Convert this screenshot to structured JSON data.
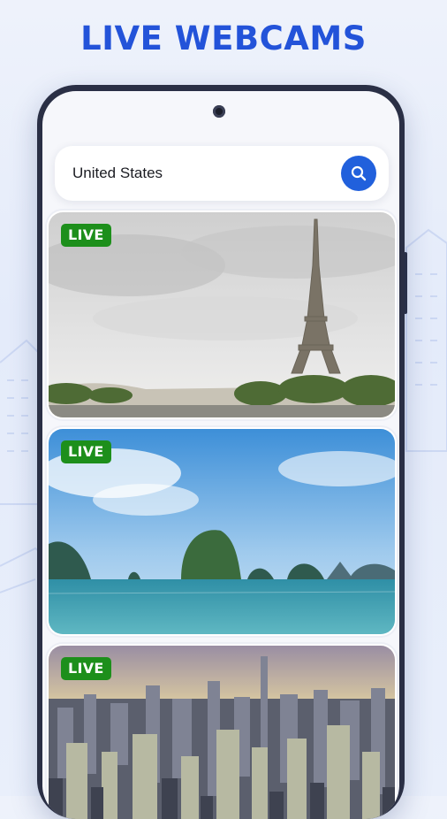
{
  "headline": "LIVE WEBCAMS",
  "search": {
    "value": "United States",
    "icon": "search-icon"
  },
  "cards": [
    {
      "badge": "LIVE",
      "scene": "eiffel-tower"
    },
    {
      "badge": "LIVE",
      "scene": "tropical-sea-islands"
    },
    {
      "badge": "LIVE",
      "scene": "city-skyline"
    }
  ],
  "colors": {
    "accent": "#2353d9",
    "search_button": "#2160dc",
    "live_badge": "#1d8f1b",
    "phone_frame": "#2a2f45"
  }
}
